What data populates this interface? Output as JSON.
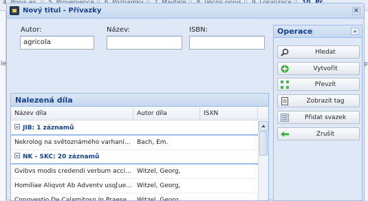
{
  "background_tabs": [
    "4. Popis ex.",
    "5. Provenience",
    "6. Poznámky",
    "7. Majitelé",
    "8. Věcný popis",
    "9. Lokalizace",
    "10. Př"
  ],
  "left_edge_text": "le",
  "right_edge_text": "p",
  "dialog": {
    "title": "Nový titul - Přívazky",
    "close_label": "×"
  },
  "search": {
    "author_label": "Autor:",
    "author_value": "agricola",
    "title_label": "Název:",
    "title_value": "",
    "isbn_label": "ISBN:",
    "isbn_value": ""
  },
  "results": {
    "header": "Nalezená díla",
    "columns": [
      "Název díla",
      "Autor díla",
      "ISXN"
    ],
    "groups": [
      {
        "label": "JIB: 1 záznamů",
        "rows": [
          {
            "title": "Nekrolog na světoznámého varhaníka, ...",
            "author": "Bach, Em.",
            "isxn": ""
          }
        ]
      },
      {
        "label": "NK - SKC: 20 záznamů",
        "rows": [
          {
            "title": "Gvibvs modis credendi verbum accipiat...",
            "author": "Witzel, Georg,",
            "isxn": ""
          },
          {
            "title": "Homiliae Aliqvot Ab Adventv usq[ue] in ...",
            "author": "Witzel, Georg,",
            "isxn": ""
          },
          {
            "title": "Conqvestio De Calamitoso In Praesens ...",
            "author": "Witzel, Georg,",
            "isxn": ""
          }
        ]
      }
    ]
  },
  "operations": {
    "header": "Operace",
    "collapse_label": "»",
    "buttons": [
      {
        "label": "Hledat",
        "icon": "search-icon"
      },
      {
        "label": "Vytvořit",
        "icon": "add-icon"
      },
      {
        "label": "Převzít",
        "icon": "transfer-icon"
      },
      {
        "label": "Zobrazit tag",
        "icon": "document-icon"
      },
      {
        "label": "Přidat svazek",
        "icon": "volume-icon"
      },
      {
        "label": "Zrušit",
        "icon": "cancel-arrow-icon"
      }
    ]
  },
  "colors": {
    "accent": "#15428b",
    "panel_bg": "#dfe8f6",
    "border": "#99bbe8"
  }
}
